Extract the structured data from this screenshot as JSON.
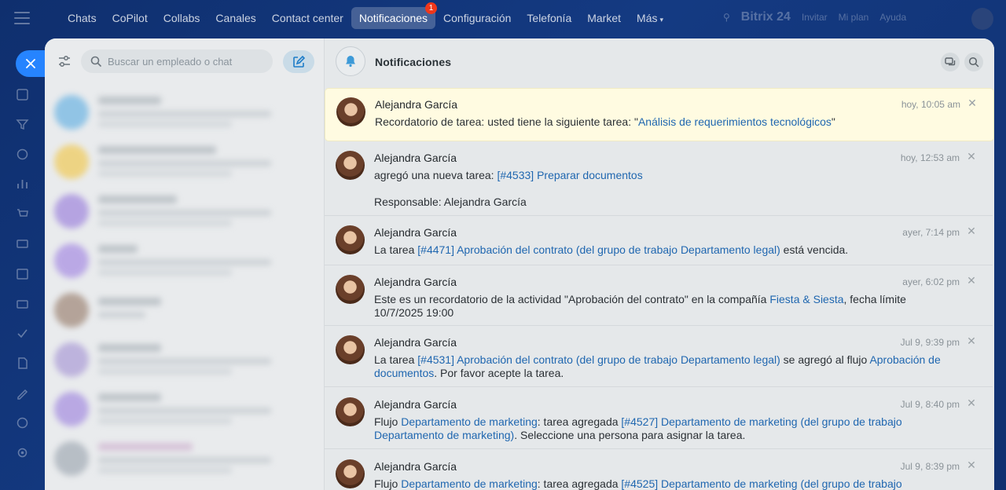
{
  "nav": {
    "items": [
      "Chats",
      "CoPilot",
      "Collabs",
      "Canales",
      "Contact center",
      "Notificaciones",
      "Configuración",
      "Telefonía",
      "Market",
      "Más"
    ],
    "active_index": 5,
    "badge": "1"
  },
  "topright": {
    "brand": "Bitrix 24",
    "links": [
      "Invitar",
      "Mi plan",
      "Ayuda"
    ]
  },
  "left": {
    "search_placeholder": "Buscar un empleado o chat"
  },
  "header": {
    "title": "Notificaciones"
  },
  "notifications": [
    {
      "name": "Alejandra García",
      "time": "hoy, 10:05 am",
      "parts": [
        {
          "t": "Recordatorio de tarea: usted tiene la siguiente tarea: \""
        },
        {
          "t": "Análisis de requerimientos tecnológicos",
          "link": true
        },
        {
          "t": "\""
        }
      ]
    },
    {
      "name": "Alejandra García",
      "time": "hoy, 12:53 am",
      "parts": [
        {
          "t": "agregó una nueva tarea: "
        },
        {
          "t": "[#4533] Preparar documentos",
          "link": true
        }
      ],
      "extra": "Responsable: Alejandra García"
    },
    {
      "name": "Alejandra García",
      "time": "ayer, 7:14 pm",
      "parts": [
        {
          "t": "La tarea "
        },
        {
          "t": "[#4471] Aprobación del contrato (del grupo de trabajo Departamento legal)",
          "link": true
        },
        {
          "t": " está vencida."
        }
      ]
    },
    {
      "name": "Alejandra García",
      "time": "ayer, 6:02 pm",
      "parts": [
        {
          "t": "Este es un recordatorio de la actividad \"Aprobación del contrato\" en la compañía "
        },
        {
          "t": "Fiesta & Siesta",
          "link": true
        },
        {
          "t": ", fecha límite 10/7/2025 19:00"
        }
      ]
    },
    {
      "name": "Alejandra García",
      "time": "Jul 9, 9:39 pm",
      "parts": [
        {
          "t": "La tarea "
        },
        {
          "t": "[#4531] Aprobación del contrato (del grupo de trabajo Departamento legal)",
          "link": true
        },
        {
          "t": " se agregó al flujo "
        },
        {
          "t": "Aprobación de documentos",
          "link": true
        },
        {
          "t": ". Por favor acepte la tarea."
        }
      ]
    },
    {
      "name": "Alejandra García",
      "time": "Jul 9, 8:40 pm",
      "parts": [
        {
          "t": "Flujo "
        },
        {
          "t": "Departamento de marketing",
          "link": true
        },
        {
          "t": ": tarea agregada "
        },
        {
          "t": "[#4527] Departamento de marketing (del grupo de trabajo Departamento de marketing)",
          "link": true
        },
        {
          "t": ". Seleccione una persona para asignar la tarea."
        }
      ]
    },
    {
      "name": "Alejandra García",
      "time": "Jul 9, 8:39 pm",
      "parts": [
        {
          "t": "Flujo "
        },
        {
          "t": "Departamento de marketing",
          "link": true
        },
        {
          "t": ": tarea agregada "
        },
        {
          "t": "[#4525] Departamento de marketing (del grupo de trabajo",
          "link": true
        }
      ]
    }
  ],
  "icons": {
    "close": "close-icon",
    "bell": "bell-icon",
    "search": "search-icon",
    "filter": "filter-icon",
    "compose": "compose-icon"
  }
}
